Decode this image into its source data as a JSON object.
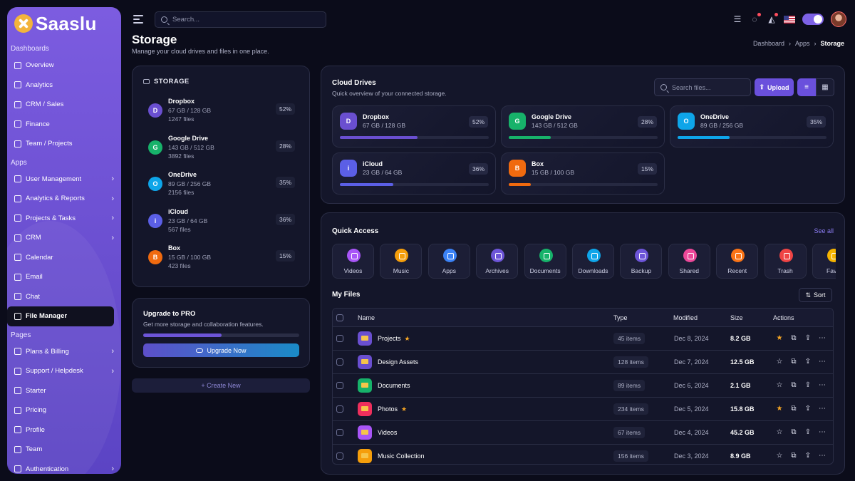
{
  "brand": {
    "name": "Saaslu"
  },
  "sidebar": {
    "sections": [
      {
        "label": "Dashboards",
        "items": [
          {
            "label": "Overview",
            "chevron": false
          },
          {
            "label": "Analytics",
            "chevron": false
          },
          {
            "label": "CRM / Sales",
            "chevron": false
          },
          {
            "label": "Finance",
            "chevron": false
          },
          {
            "label": "Team / Projects",
            "chevron": false
          }
        ]
      },
      {
        "label": "Apps",
        "items": [
          {
            "label": "User Management",
            "chevron": true
          },
          {
            "label": "Analytics & Reports",
            "chevron": true
          },
          {
            "label": "Projects & Tasks",
            "chevron": true
          },
          {
            "label": "CRM",
            "chevron": true
          },
          {
            "label": "Calendar",
            "chevron": false
          },
          {
            "label": "Email",
            "chevron": false
          },
          {
            "label": "Chat",
            "chevron": false
          },
          {
            "label": "File Manager",
            "chevron": false,
            "active": true
          }
        ]
      },
      {
        "label": "Pages",
        "items": [
          {
            "label": "Plans & Billing",
            "chevron": true
          },
          {
            "label": "Support / Helpdesk",
            "chevron": true
          },
          {
            "label": "Starter",
            "chevron": false
          },
          {
            "label": "Pricing",
            "chevron": false
          },
          {
            "label": "Profile",
            "chevron": false
          },
          {
            "label": "Team",
            "chevron": false
          },
          {
            "label": "Authentication",
            "chevron": true
          }
        ]
      }
    ]
  },
  "topbar": {
    "search_placeholder": "Search..."
  },
  "page": {
    "title": "Storage",
    "subtitle": "Manage your cloud drives and files in one place."
  },
  "breadcrumb": {
    "items": [
      "Dashboard",
      "Apps"
    ],
    "current": "Storage"
  },
  "storage_panel": {
    "title": "STORAGE",
    "drives": [
      {
        "letter": "D",
        "name": "Dropbox",
        "usage": "67 GB / 128 GB",
        "files": "1247 files",
        "percent": "52%",
        "color": "#6a4fd0"
      },
      {
        "letter": "G",
        "name": "Google Drive",
        "usage": "143 GB / 512 GB",
        "files": "3892 files",
        "percent": "28%",
        "color": "#17b26a"
      },
      {
        "letter": "O",
        "name": "OneDrive",
        "usage": "89 GB / 256 GB",
        "files": "2156 files",
        "percent": "35%",
        "color": "#0ea5e9"
      },
      {
        "letter": "i",
        "name": "iCloud",
        "usage": "23 GB / 64 GB",
        "files": "567 files",
        "percent": "36%",
        "color": "#5b5fe6"
      },
      {
        "letter": "B",
        "name": "Box",
        "usage": "15 GB / 100 GB",
        "files": "423 files",
        "percent": "15%",
        "color": "#f06a0f"
      }
    ]
  },
  "upgrade": {
    "title": "Upgrade to PRO",
    "subtitle": "Get more storage and collaboration features.",
    "progress": 0.5,
    "button": "Upgrade Now"
  },
  "create_new": "+ Create New",
  "cloud_drives": {
    "title": "Cloud Drives",
    "subtitle": "Quick overview of your connected storage.",
    "search_placeholder": "Search files...",
    "upload_label": "Upload",
    "cards": [
      {
        "letter": "D",
        "name": "Dropbox",
        "usage": "67 GB / 128 GB",
        "percent": "52%",
        "fill": 0.52,
        "color": "#6a4fd0",
        "bar": "#6a4fd0"
      },
      {
        "letter": "G",
        "name": "Google Drive",
        "usage": "143 GB / 512 GB",
        "percent": "28%",
        "fill": 0.28,
        "color": "#17b26a",
        "bar": "#17b26a"
      },
      {
        "letter": "O",
        "name": "OneDrive",
        "usage": "89 GB / 256 GB",
        "percent": "35%",
        "fill": 0.35,
        "color": "#0ea5e9",
        "bar": "#0ea5e9"
      },
      {
        "letter": "i",
        "name": "iCloud",
        "usage": "23 GB / 64 GB",
        "percent": "36%",
        "fill": 0.36,
        "color": "#5b5fe6",
        "bar": "#5b5fe6"
      },
      {
        "letter": "B",
        "name": "Box",
        "usage": "15 GB / 100 GB",
        "percent": "15%",
        "fill": 0.15,
        "color": "#f06a0f",
        "bar": "#f06a0f"
      }
    ]
  },
  "quick_access": {
    "title": "Quick Access",
    "see_all": "See all",
    "items": [
      {
        "label": "Videos",
        "color": "#a855f7",
        "icon": "video-icon"
      },
      {
        "label": "Music",
        "color": "#f59e0b",
        "icon": "music-icon"
      },
      {
        "label": "Apps",
        "color": "#3b82f6",
        "icon": "apps-icon"
      },
      {
        "label": "Archives",
        "color": "#6d55d8",
        "icon": "archive-icon"
      },
      {
        "label": "Documents",
        "color": "#17b26a",
        "icon": "document-icon"
      },
      {
        "label": "Downloads",
        "color": "#0ea5e9",
        "icon": "download-icon"
      },
      {
        "label": "Backup",
        "color": "#6d55d8",
        "icon": "cloud-icon"
      },
      {
        "label": "Shared",
        "color": "#ec4899",
        "icon": "share-icon"
      },
      {
        "label": "Recent",
        "color": "#f97316",
        "icon": "star-icon"
      },
      {
        "label": "Trash",
        "color": "#ef4444",
        "icon": "trash-icon"
      },
      {
        "label": "Favo",
        "color": "#f5b400",
        "icon": "favorite-icon"
      }
    ]
  },
  "my_files": {
    "title": "My Files",
    "sort_label": "Sort",
    "columns": {
      "name": "Name",
      "type": "Type",
      "modified": "Modified",
      "size": "Size",
      "actions": "Actions"
    },
    "rows": [
      {
        "name": "Projects",
        "starred": true,
        "type": "45 items",
        "modified": "Dec 8, 2024",
        "size": "8.2 GB",
        "color": "#6a4fd0"
      },
      {
        "name": "Design Assets",
        "starred": false,
        "type": "128 items",
        "modified": "Dec 7, 2024",
        "size": "12.5 GB",
        "color": "#6a4fd0"
      },
      {
        "name": "Documents",
        "starred": false,
        "type": "89 items",
        "modified": "Dec 6, 2024",
        "size": "2.1 GB",
        "color": "#17b26a"
      },
      {
        "name": "Photos",
        "starred": true,
        "type": "234 items",
        "modified": "Dec 5, 2024",
        "size": "15.8 GB",
        "color": "#ef2f5c"
      },
      {
        "name": "Videos",
        "starred": false,
        "type": "67 items",
        "modified": "Dec 4, 2024",
        "size": "45.2 GB",
        "color": "#a855f7"
      },
      {
        "name": "Music Collection",
        "starred": false,
        "type": "156 items",
        "modified": "Dec 3, 2024",
        "size": "8.9 GB",
        "color": "#f59e0b"
      }
    ]
  }
}
